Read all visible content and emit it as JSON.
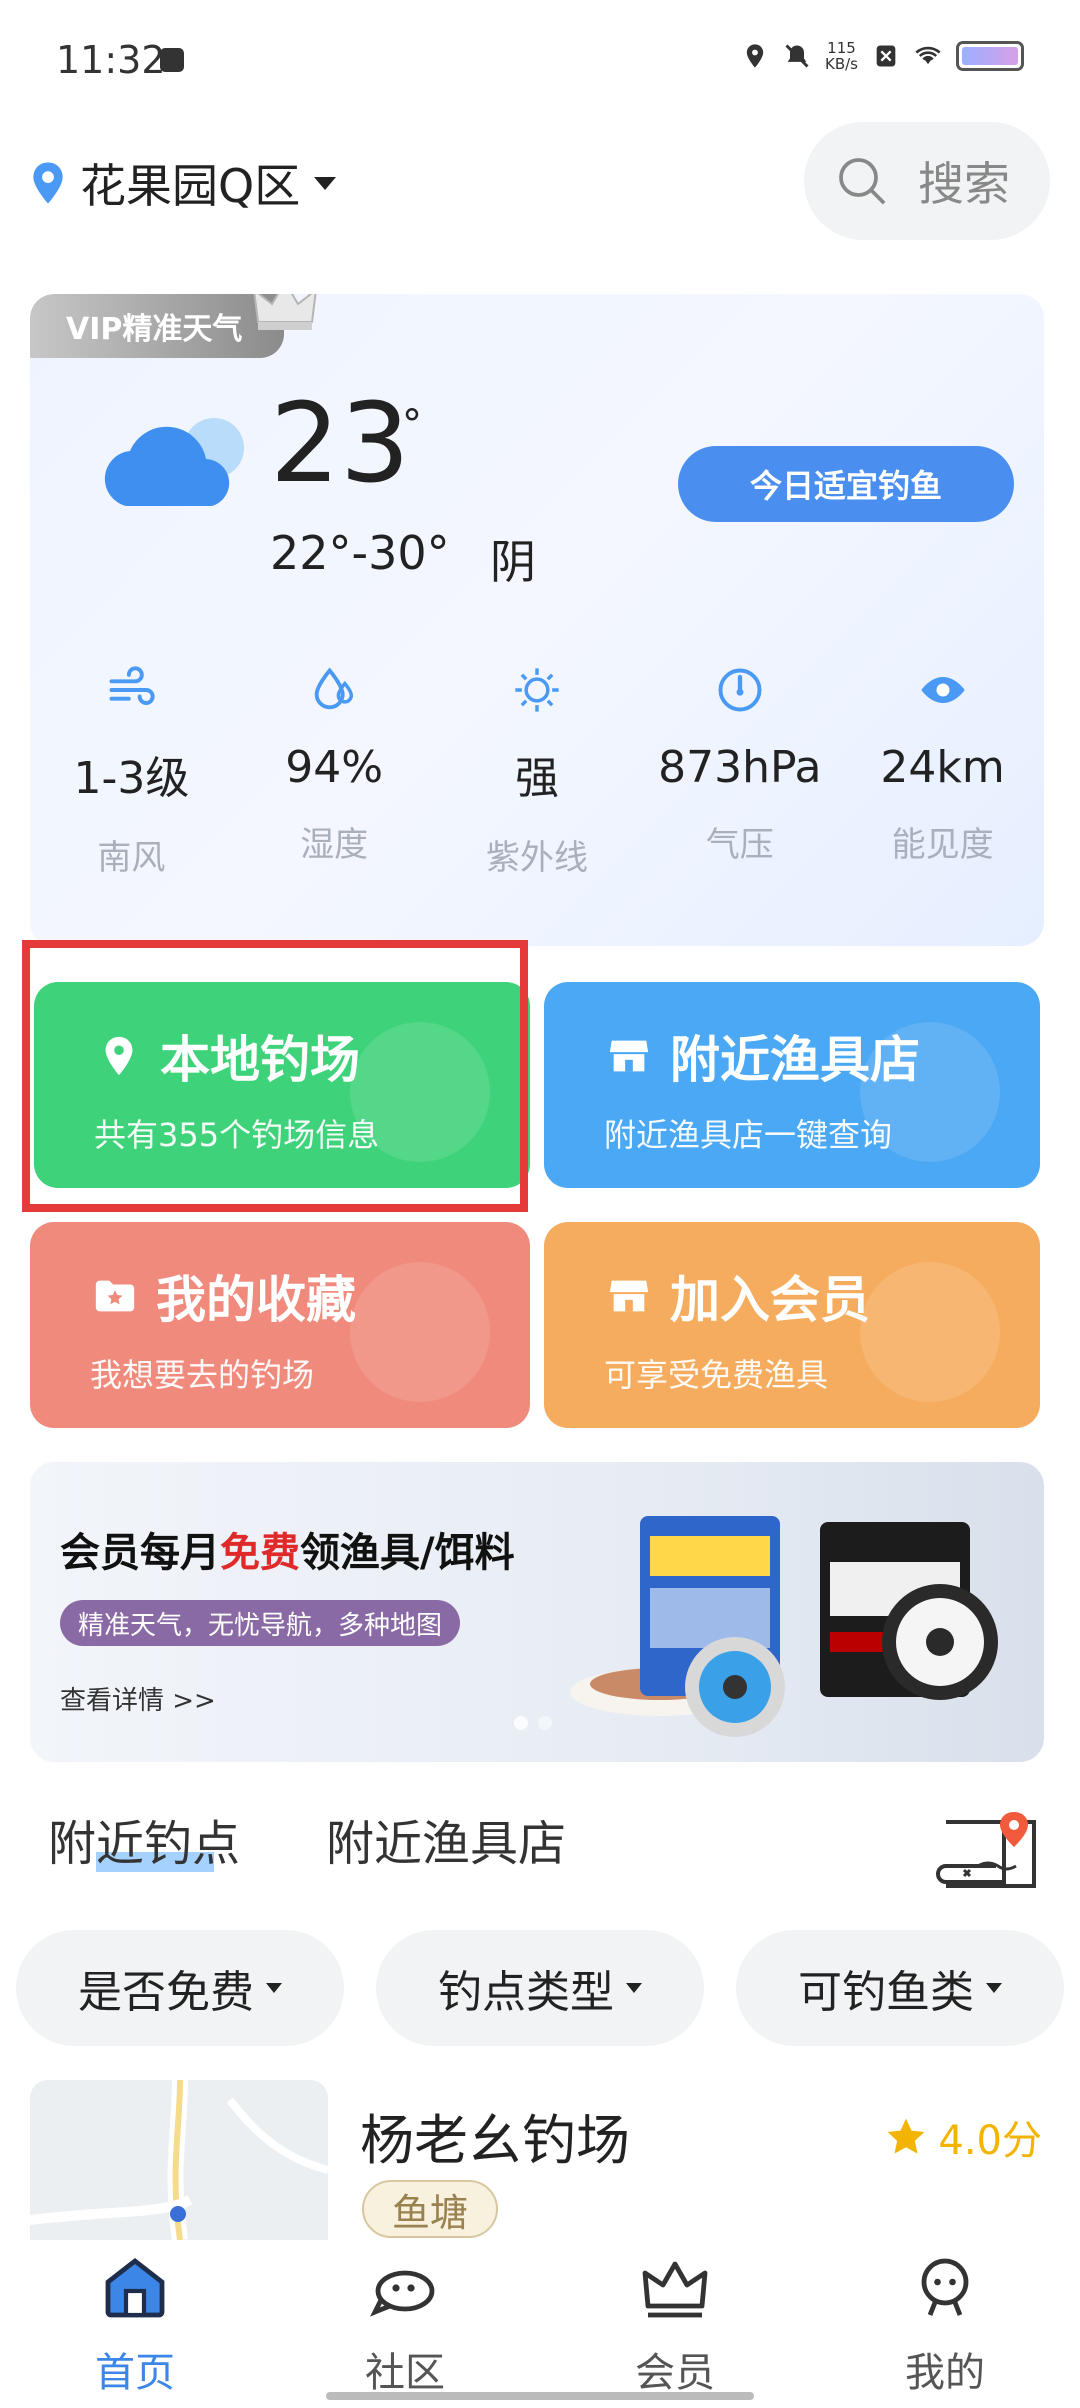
{
  "status_bar": {
    "time": "11:32",
    "net_speed_value": "115",
    "net_speed_unit": "KB/s"
  },
  "header": {
    "location": "花果园Q区",
    "search_label": "搜索"
  },
  "weather": {
    "vip_label": "VIP精准天气",
    "temperature": "23",
    "degree": "°",
    "range": "22°-30°",
    "condition": "阴",
    "fishing_button": "今日适宜钓鱼",
    "stats": [
      {
        "value": "1-3级",
        "label": "南风",
        "icon": "wind-icon"
      },
      {
        "value": "94%",
        "label": "湿度",
        "icon": "humidity-icon"
      },
      {
        "value": "强",
        "label": "紫外线",
        "icon": "uv-icon"
      },
      {
        "value": "873hPa",
        "label": "气压",
        "icon": "pressure-icon"
      },
      {
        "value": "24km",
        "label": "能见度",
        "icon": "visibility-icon"
      }
    ]
  },
  "features": {
    "local": {
      "title": "本地钓场",
      "subtitle": "共有355个钓场信息",
      "color": "#3ed27a"
    },
    "store": {
      "title": "附近渔具店",
      "subtitle": "附近渔具店一键查询",
      "color": "#4aa8f4"
    },
    "favorites": {
      "title": "我的收藏",
      "subtitle": "我想要去的钓场",
      "color": "#ef8a7c"
    },
    "vip": {
      "title": "加入会员",
      "subtitle": "可享受免费渔具",
      "color": "#f6ac5e"
    }
  },
  "banner": {
    "title_before": "会员每月",
    "title_highlight": "免费",
    "title_after": "领渔具/饵料",
    "tag": "精准天气，无忧导航，多种地图",
    "link": "查看详情 >>"
  },
  "tabs": [
    "附近钓点",
    "附近渔具店"
  ],
  "filters": [
    "是否免费",
    "钓点类型",
    "可钓鱼类"
  ],
  "spot": {
    "name": "杨老幺钓场",
    "tag": "鱼塘",
    "rating": "4.0分"
  },
  "nav": [
    {
      "label": "首页",
      "icon": "home-icon",
      "active": true
    },
    {
      "label": "社区",
      "icon": "community-icon",
      "active": false
    },
    {
      "label": "会员",
      "icon": "crown-icon",
      "active": false
    },
    {
      "label": "我的",
      "icon": "profile-icon",
      "active": false
    }
  ],
  "colors": {
    "accent": "#3b86e6",
    "highlight_border": "#e53a3a",
    "rating": "#f3b400"
  }
}
